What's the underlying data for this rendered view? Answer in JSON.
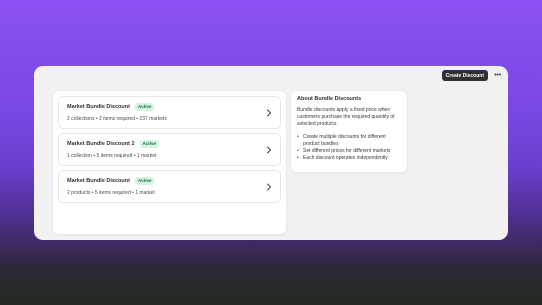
{
  "toolbar": {
    "create_label": "Create Discount",
    "more_icon": "ellipsis-icon"
  },
  "discounts": [
    {
      "name": "Market Bundle Discount",
      "status": "Active",
      "meta": "2 collections • 2 items required • 237 markets"
    },
    {
      "name": "Market Bundle Discount 2",
      "status": "Active",
      "meta": "1 collection • 5 items required • 1 market"
    },
    {
      "name": "Market Bundle Discount",
      "status": "Active",
      "meta": "2 products • 5 items required • 1 market"
    }
  ],
  "info": {
    "title": "About Bundle Discounts",
    "description": "Bundle discounts apply a fixed price when customers purchase the required quantity of selected products.",
    "bullets": [
      "Create multiple discounts for different product bundles",
      "Set different prices for different markets",
      "Each discount operates independently"
    ]
  },
  "colors": {
    "badge_bg": "#d6f5df",
    "badge_text": "#1f6b3a",
    "primary_button": "#303030"
  }
}
